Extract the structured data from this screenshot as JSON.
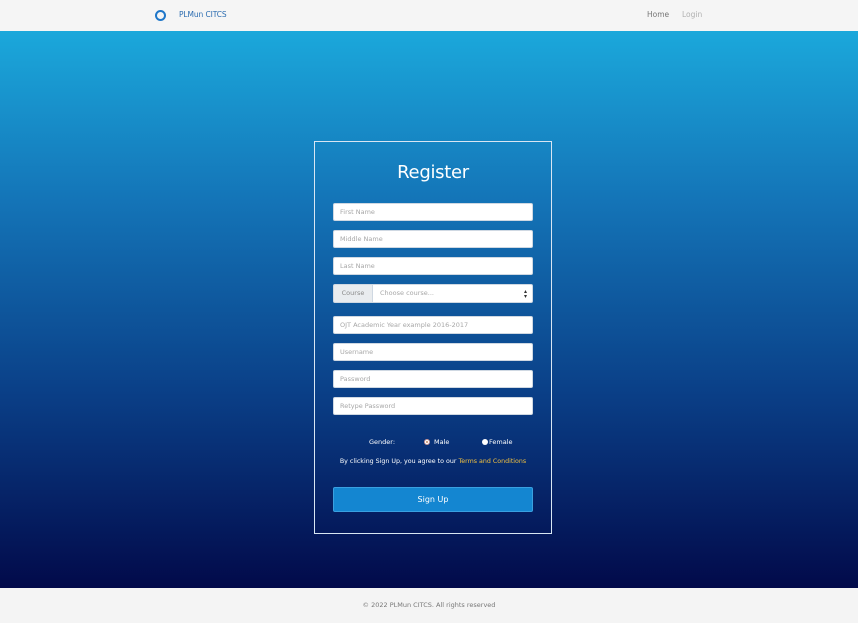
{
  "navbar": {
    "brand": "PLMun CITCS",
    "links": [
      {
        "label": "Home"
      },
      {
        "label": "Login"
      }
    ]
  },
  "form": {
    "title": "Register",
    "fields": {
      "first_name": {
        "placeholder": "First Name",
        "value": ""
      },
      "middle_name": {
        "placeholder": "Middle Name",
        "value": ""
      },
      "last_name": {
        "placeholder": "Last Name",
        "value": ""
      },
      "ojt_year": {
        "placeholder": "OJT Academic Year example 2016-2017",
        "value": ""
      },
      "username": {
        "placeholder": "Username",
        "value": ""
      },
      "password": {
        "placeholder": "Password",
        "value": ""
      },
      "retype_password": {
        "placeholder": "Retype Password",
        "value": ""
      }
    },
    "course": {
      "addon_label": "Course",
      "selected": "Choose course..."
    },
    "gender": {
      "label": "Gender:",
      "options": [
        "Male",
        "Female"
      ],
      "selected": "Male"
    },
    "terms": {
      "prefix": "By clicking Sign Up, you agree to our",
      "link": "Terms and Conditions"
    },
    "submit_label": "Sign Up"
  },
  "footer": {
    "text": "© 2022 PLMun CITCS. All rights reserved"
  },
  "colors": {
    "gradient_top": "#1ba8db",
    "gradient_bottom": "#020a4a",
    "button": "#1486d1",
    "terms_link": "#f0c040"
  }
}
